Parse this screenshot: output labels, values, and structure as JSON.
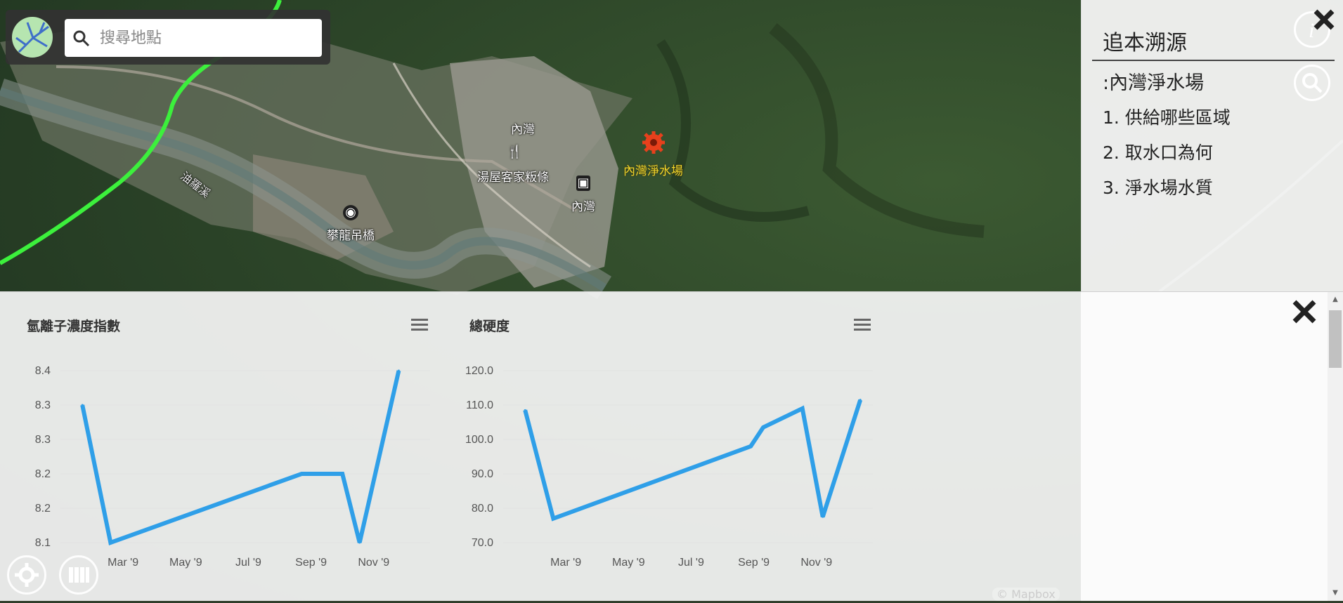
{
  "search": {
    "placeholder": "搜尋地點"
  },
  "map": {
    "labels": [
      {
        "text": "內灣",
        "name": "village-label-neiwan"
      },
      {
        "text": "湯屋客家粄條",
        "name": "poi-label-restaurant"
      },
      {
        "text": "內灣",
        "name": "station-label-neiwan"
      },
      {
        "text": "內灣淨水場",
        "name": "poi-label-water-plant"
      },
      {
        "text": "攀龍吊橋",
        "name": "poi-label-bridge"
      },
      {
        "text": "油羅溪",
        "name": "river-label"
      }
    ],
    "attribution": "© Mapbox"
  },
  "side_panel": {
    "title": "追本溯源",
    "subtitle": ":內灣淨水場",
    "items": [
      "1. 供給哪些區域",
      "2. 取水口為何",
      "3. 淨水場水質"
    ]
  },
  "chart_data": [
    {
      "type": "line",
      "title": "氫離子濃度指數",
      "x_labels": [
        "Mar '9",
        "May '9",
        "Jul '9",
        "Sep '9",
        "Nov '9"
      ],
      "y_tick_labels": [
        "8.4",
        "8.3",
        "8.3",
        "8.2",
        "8.2",
        "8.1"
      ],
      "ylim": [
        8.1,
        8.4
      ],
      "series": [
        {
          "color": "#2f9fe8",
          "points": [
            [
              1.7,
              8.34
            ],
            [
              2.6,
              8.1
            ],
            [
              8.7,
              8.22
            ],
            [
              10.0,
              8.22
            ],
            [
              10.55,
              8.1
            ],
            [
              11.8,
              8.4
            ]
          ]
        }
      ],
      "grid": true
    },
    {
      "type": "line",
      "title": "總硬度",
      "x_labels": [
        "Mar '9",
        "May '9",
        "Jul '9",
        "Sep '9",
        "Nov '9"
      ],
      "y_tick_labels": [
        "120.0",
        "110.0",
        "100.0",
        "90.0",
        "80.0",
        "70.0"
      ],
      "ylim": [
        70,
        120
      ],
      "series": [
        {
          "color": "#2f9fe8",
          "points": [
            [
              1.7,
              108.5
            ],
            [
              2.6,
              77
            ],
            [
              8.9,
              98
            ],
            [
              9.3,
              103.5
            ],
            [
              10.55,
              109
            ],
            [
              11.2,
              77.5
            ],
            [
              12.4,
              111.5
            ]
          ]
        }
      ],
      "grid": true
    }
  ],
  "x_axis_range": [
    1.0,
    12.8
  ],
  "colors": {
    "line": "#2f9fe8",
    "grid": "#e2e2e2",
    "panel": "#f5f5f5"
  },
  "icons": [
    "logo-icon",
    "search-icon",
    "close-icon",
    "info-icon",
    "magnifier-icon",
    "menu-icon",
    "settings-icon",
    "layers-icon",
    "restaurant-icon",
    "train-icon",
    "camera-icon",
    "gear-marker-icon"
  ]
}
